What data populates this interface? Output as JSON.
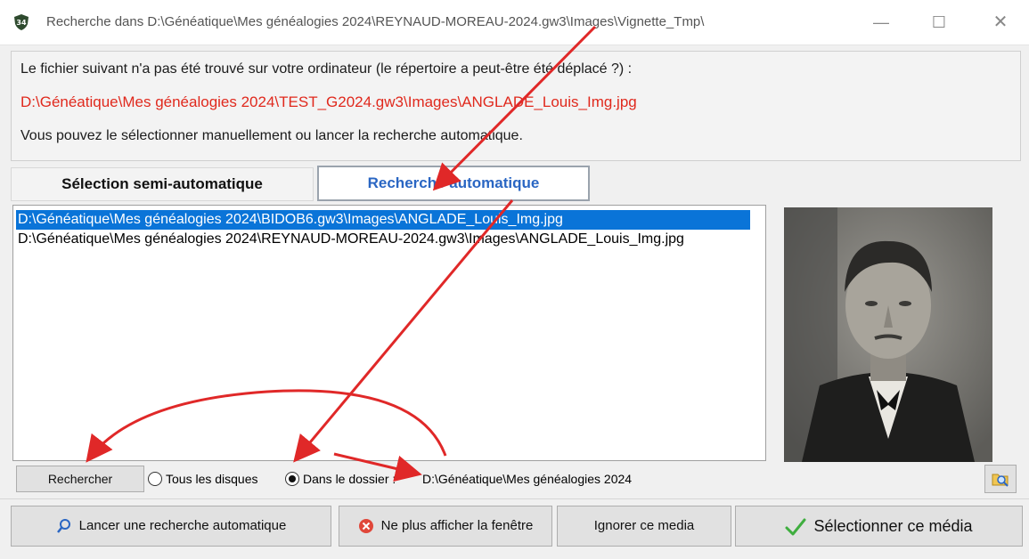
{
  "window": {
    "title": "Recherche dans D:\\Généatique\\Mes généalogies 2024\\REYNAUD-MOREAU-2024.gw3\\Images\\Vignette_Tmp\\",
    "app_icon": "geneatique-shield-icon",
    "controls": {
      "minimize": "—",
      "maximize": "☐",
      "close": "✕"
    }
  },
  "info": {
    "line1": "Le fichier suivant n'a pas été trouvé sur votre ordinateur (le répertoire a peut-être été déplacé ?) :",
    "missing_file": "D:\\Généatique\\Mes généalogies 2024\\TEST_G2024.gw3\\Images\\ANGLADE_Louis_Img.jpg",
    "line3": "Vous pouvez le sélectionner manuellement ou lancer la recherche automatique."
  },
  "tabs": [
    {
      "label": "Sélection semi-automatique",
      "active": false
    },
    {
      "label": "Recherche automatique",
      "active": true
    }
  ],
  "results": [
    {
      "path": "D:\\Généatique\\Mes généalogies 2024\\BIDOB6.gw3\\Images\\ANGLADE_Louis_Img.jpg",
      "selected": true
    },
    {
      "path": "D:\\Généatique\\Mes généalogies 2024\\REYNAUD-MOREAU-2024.gw3\\Images\\ANGLADE_Louis_Img.jpg",
      "selected": false
    }
  ],
  "search": {
    "button": "Rechercher",
    "option_all_disks": "Tous les disques",
    "option_folder": "Dans le dossier :",
    "selected_option": "folder",
    "folder_path": "D:\\Généatique\\Mes généalogies 2024",
    "browse_icon": "folder-search-icon"
  },
  "actions": {
    "auto_search": {
      "label": "Lancer une recherche automatique",
      "icon": "magnifier-icon"
    },
    "hide_window": {
      "label": "Ne plus afficher la fenêtre",
      "icon": "red-x-icon"
    },
    "ignore_media": {
      "label": "Ignorer ce media"
    },
    "select_media": {
      "label": "Sélectionner ce média",
      "icon": "green-check-icon"
    }
  },
  "colors": {
    "error_text": "#e0291d",
    "selection": "#0a74d8",
    "active_tab_text": "#2a66c3",
    "annotation_arrow": "#e02828"
  }
}
